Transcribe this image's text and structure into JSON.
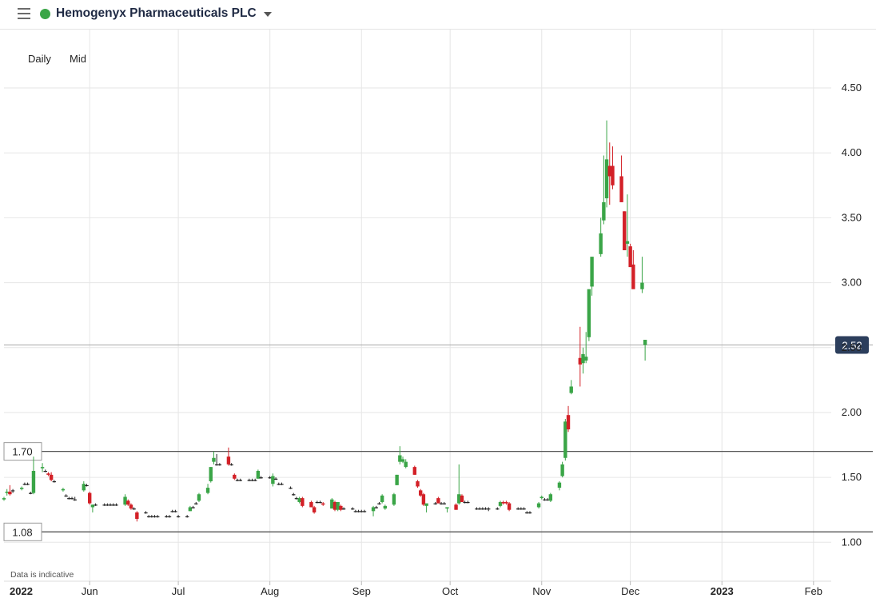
{
  "header": {
    "instrument_name": "Hemogenyx Pharmaceuticals PLC",
    "status_color": "#3aa547",
    "menu_icon": "hamburger-menu-icon",
    "dropdown_icon": "caret-down-icon"
  },
  "controls": {
    "interval": "Daily",
    "price_type": "Mid"
  },
  "footer": {
    "note": "Data is indicative"
  },
  "chart_data": {
    "type": "candlestick",
    "yticks": [
      "4.50",
      "4.00",
      "3.50",
      "3.00",
      "2.50",
      "2.00",
      "1.50",
      "1.00"
    ],
    "ylim": [
      0.7,
      4.95
    ],
    "x_labels": [
      {
        "label": "2022",
        "date": "2022-05-01",
        "bold": true
      },
      {
        "label": "Jun",
        "date": "2022-06-01"
      },
      {
        "label": "Jul",
        "date": "2022-07-01"
      },
      {
        "label": "Aug",
        "date": "2022-08-01"
      },
      {
        "label": "Sep",
        "date": "2022-09-01"
      },
      {
        "label": "Oct",
        "date": "2022-10-01"
      },
      {
        "label": "Nov",
        "date": "2022-11-01"
      },
      {
        "label": "Dec",
        "date": "2022-12-01"
      },
      {
        "label": "2023",
        "date": "2023-01-01",
        "bold": true
      },
      {
        "label": "Feb",
        "date": "2023-02-01"
      }
    ],
    "xlim": [
      "2022-05-03",
      "2023-02-07"
    ],
    "last_price": {
      "value": 2.52,
      "label": "2.52",
      "color": "#2c3e5c"
    },
    "levels": [
      {
        "value": 1.7,
        "label": "1.70"
      },
      {
        "value": 1.08,
        "label": "1.08"
      }
    ],
    "colors": {
      "up": "#3aa547",
      "down": "#d32027",
      "flat": "#222222",
      "grid": "#e6e6e6"
    },
    "dates_start": "2022-05-03",
    "candles": [
      [
        1.33,
        1.35,
        1.32,
        1.34
      ],
      [
        1.38,
        1.41,
        1.36,
        1.39
      ],
      [
        1.39,
        1.44,
        1.36,
        1.37
      ],
      [
        1.4,
        1.41,
        1.38,
        1.4
      ],
      [
        1.41,
        1.43,
        1.4,
        1.42
      ],
      [
        1.45,
        1.46,
        1.44,
        1.45
      ],
      [
        1.45,
        1.46,
        1.44,
        1.45
      ],
      [
        1.38,
        1.39,
        1.37,
        1.38
      ],
      [
        1.38,
        1.66,
        1.37,
        1.55
      ],
      [
        1.57,
        1.61,
        1.54,
        1.58
      ],
      [
        1.55,
        1.56,
        1.54,
        1.55
      ],
      [
        1.53,
        1.54,
        1.51,
        1.52
      ],
      [
        1.52,
        1.54,
        1.47,
        1.48
      ],
      [
        1.47,
        1.48,
        1.46,
        1.47
      ],
      [
        1.4,
        1.42,
        1.39,
        1.41
      ],
      [
        1.36,
        1.37,
        1.35,
        1.36
      ],
      [
        1.34,
        1.35,
        1.33,
        1.34
      ],
      [
        1.34,
        1.35,
        1.33,
        1.34
      ],
      [
        1.33,
        1.35,
        1.32,
        1.33
      ],
      [
        1.4,
        1.47,
        1.39,
        1.45
      ],
      [
        1.44,
        1.45,
        1.43,
        1.44
      ],
      [
        1.38,
        1.39,
        1.29,
        1.3
      ],
      [
        1.27,
        1.29,
        1.23,
        1.29
      ],
      [
        1.29,
        1.3,
        1.28,
        1.29
      ],
      [
        1.29,
        1.3,
        1.28,
        1.29
      ],
      [
        1.29,
        1.3,
        1.28,
        1.29
      ],
      [
        1.29,
        1.3,
        1.28,
        1.29
      ],
      [
        1.29,
        1.3,
        1.28,
        1.29
      ],
      [
        1.29,
        1.3,
        1.28,
        1.29
      ],
      [
        1.29,
        1.37,
        1.28,
        1.35
      ],
      [
        1.32,
        1.33,
        1.28,
        1.29
      ],
      [
        1.29,
        1.3,
        1.25,
        1.26
      ],
      [
        1.26,
        1.27,
        1.25,
        1.26
      ],
      [
        1.23,
        1.24,
        1.16,
        1.18
      ],
      [
        1.23,
        1.24,
        1.22,
        1.23
      ],
      [
        1.2,
        1.21,
        1.19,
        1.2
      ],
      [
        1.2,
        1.21,
        1.19,
        1.2
      ],
      [
        1.2,
        1.21,
        1.19,
        1.2
      ],
      [
        1.2,
        1.21,
        1.19,
        1.2
      ],
      [
        1.2,
        1.21,
        1.19,
        1.2
      ],
      [
        1.2,
        1.21,
        1.19,
        1.2
      ],
      [
        1.24,
        1.25,
        1.23,
        1.24
      ],
      [
        1.24,
        1.25,
        1.23,
        1.24
      ],
      [
        1.2,
        1.21,
        1.19,
        1.2
      ],
      [
        1.2,
        1.21,
        1.19,
        1.2
      ],
      [
        1.24,
        1.28,
        1.24,
        1.27
      ],
      [
        1.27,
        1.28,
        1.26,
        1.27
      ],
      [
        1.3,
        1.31,
        1.29,
        1.3
      ],
      [
        1.32,
        1.38,
        1.31,
        1.37
      ],
      [
        1.38,
        1.45,
        1.37,
        1.42
      ],
      [
        1.47,
        1.58,
        1.46,
        1.58
      ],
      [
        1.62,
        1.7,
        1.6,
        1.65
      ],
      [
        1.6,
        1.68,
        1.59,
        1.6
      ],
      [
        1.6,
        1.61,
        1.59,
        1.6
      ],
      [
        1.66,
        1.73,
        1.59,
        1.6
      ],
      [
        1.6,
        1.61,
        1.59,
        1.6
      ],
      [
        1.52,
        1.53,
        1.48,
        1.49
      ],
      [
        1.48,
        1.49,
        1.47,
        1.48
      ],
      [
        1.48,
        1.49,
        1.47,
        1.48
      ],
      [
        1.48,
        1.49,
        1.47,
        1.48
      ],
      [
        1.48,
        1.49,
        1.47,
        1.48
      ],
      [
        1.48,
        1.49,
        1.47,
        1.48
      ],
      [
        1.49,
        1.56,
        1.49,
        1.55
      ],
      [
        1.5,
        1.51,
        1.49,
        1.5
      ],
      [
        1.5,
        1.51,
        1.49,
        1.5
      ],
      [
        1.45,
        1.53,
        1.43,
        1.51
      ],
      [
        1.49,
        1.5,
        1.48,
        1.49
      ],
      [
        1.45,
        1.46,
        1.44,
        1.45
      ],
      [
        1.45,
        1.46,
        1.44,
        1.45
      ],
      [
        1.42,
        1.43,
        1.41,
        1.42
      ],
      [
        1.37,
        1.38,
        1.36,
        1.37
      ],
      [
        1.34,
        1.35,
        1.33,
        1.34
      ],
      [
        1.31,
        1.35,
        1.3,
        1.34
      ],
      [
        1.34,
        1.35,
        1.27,
        1.28
      ],
      [
        1.31,
        1.32,
        1.27,
        1.27
      ],
      [
        1.27,
        1.28,
        1.22,
        1.23
      ],
      [
        1.31,
        1.32,
        1.3,
        1.31
      ],
      [
        1.31,
        1.32,
        1.3,
        1.31
      ],
      [
        1.3,
        1.31,
        1.28,
        1.29
      ],
      [
        1.26,
        1.34,
        1.26,
        1.33
      ],
      [
        1.31,
        1.32,
        1.24,
        1.25
      ],
      [
        1.25,
        1.31,
        1.24,
        1.31
      ],
      [
        1.28,
        1.29,
        1.24,
        1.25
      ],
      [
        1.26,
        1.27,
        1.25,
        1.26
      ],
      [
        1.26,
        1.27,
        1.25,
        1.26
      ],
      [
        1.24,
        1.25,
        1.23,
        1.24
      ],
      [
        1.24,
        1.25,
        1.23,
        1.24
      ],
      [
        1.24,
        1.25,
        1.23,
        1.24
      ],
      [
        1.24,
        1.25,
        1.23,
        1.24
      ],
      [
        1.24,
        1.28,
        1.2,
        1.27
      ],
      [
        1.27,
        1.28,
        1.26,
        1.27
      ],
      [
        1.3,
        1.31,
        1.29,
        1.3
      ],
      [
        1.31,
        1.37,
        1.3,
        1.36
      ],
      [
        1.26,
        1.29,
        1.25,
        1.28
      ],
      [
        1.29,
        1.38,
        1.28,
        1.37
      ],
      [
        1.44,
        1.52,
        1.44,
        1.52
      ],
      [
        1.62,
        1.74,
        1.6,
        1.67
      ],
      [
        1.62,
        1.66,
        1.61,
        1.64
      ],
      [
        1.58,
        1.64,
        1.57,
        1.62
      ],
      [
        1.58,
        1.59,
        1.52,
        1.52
      ],
      [
        1.47,
        1.48,
        1.42,
        1.43
      ],
      [
        1.4,
        1.41,
        1.35,
        1.36
      ],
      [
        1.37,
        1.38,
        1.28,
        1.29
      ],
      [
        1.28,
        1.29,
        1.23,
        1.3
      ],
      [
        1.3,
        1.31,
        1.29,
        1.3
      ],
      [
        1.34,
        1.35,
        1.3,
        1.3
      ],
      [
        1.3,
        1.31,
        1.29,
        1.3
      ],
      [
        1.3,
        1.31,
        1.29,
        1.3
      ],
      [
        1.26,
        1.27,
        1.23,
        1.27
      ],
      [
        1.29,
        1.3,
        1.25,
        1.25
      ],
      [
        1.3,
        1.6,
        1.29,
        1.37
      ],
      [
        1.36,
        1.37,
        1.31,
        1.31
      ],
      [
        1.31,
        1.32,
        1.3,
        1.31
      ],
      [
        1.31,
        1.32,
        1.3,
        1.31
      ],
      [
        1.26,
        1.27,
        1.25,
        1.26
      ],
      [
        1.26,
        1.27,
        1.25,
        1.26
      ],
      [
        1.26,
        1.27,
        1.25,
        1.26
      ],
      [
        1.26,
        1.27,
        1.25,
        1.26
      ],
      [
        1.26,
        1.27,
        1.24,
        1.26
      ],
      [
        1.26,
        1.27,
        1.25,
        1.26
      ],
      [
        1.28,
        1.32,
        1.27,
        1.31
      ],
      [
        1.31,
        1.32,
        1.29,
        1.3
      ],
      [
        1.31,
        1.32,
        1.29,
        1.3
      ],
      [
        1.3,
        1.31,
        1.24,
        1.25
      ],
      [
        1.26,
        1.27,
        1.25,
        1.26
      ],
      [
        1.26,
        1.27,
        1.25,
        1.26
      ],
      [
        1.26,
        1.27,
        1.25,
        1.26
      ],
      [
        1.23,
        1.24,
        1.22,
        1.23
      ],
      [
        1.23,
        1.24,
        1.22,
        1.23
      ],
      [
        1.27,
        1.31,
        1.26,
        1.3
      ],
      [
        1.34,
        1.36,
        1.33,
        1.35
      ],
      [
        1.33,
        1.34,
        1.32,
        1.33
      ],
      [
        1.33,
        1.34,
        1.32,
        1.33
      ],
      [
        1.32,
        1.38,
        1.31,
        1.37
      ],
      [
        1.42,
        1.47,
        1.4,
        1.46
      ],
      [
        1.51,
        1.62,
        1.5,
        1.6
      ],
      [
        1.65,
        1.95,
        1.63,
        1.93
      ],
      [
        1.98,
        2.05,
        1.85,
        1.87
      ],
      [
        2.15,
        2.25,
        2.14,
        2.2
      ],
      [
        2.42,
        2.66,
        2.2,
        2.37
      ],
      [
        2.38,
        2.5,
        2.3,
        2.45
      ],
      [
        2.4,
        2.62,
        2.38,
        2.43
      ],
      [
        2.58,
        2.88,
        2.55,
        2.95
      ],
      [
        2.97,
        3.15,
        2.9,
        3.2
      ],
      [
        3.22,
        3.5,
        3.2,
        3.38
      ],
      [
        3.48,
        3.98,
        3.45,
        3.62
      ],
      [
        3.65,
        4.25,
        3.58,
        3.95
      ],
      [
        3.9,
        4.08,
        3.6,
        3.82
      ],
      [
        3.9,
        4.05,
        3.72,
        3.75
      ],
      [
        3.82,
        3.98,
        3.7,
        3.62
      ],
      [
        3.55,
        3.55,
        3.3,
        3.25
      ],
      [
        3.3,
        3.68,
        3.2,
        3.32
      ],
      [
        3.28,
        3.3,
        3.15,
        3.12
      ],
      [
        3.14,
        3.25,
        3.05,
        2.95
      ],
      [
        2.95,
        3.2,
        2.92,
        3.0
      ],
      [
        2.52,
        2.52,
        2.4,
        2.56
      ]
    ]
  }
}
